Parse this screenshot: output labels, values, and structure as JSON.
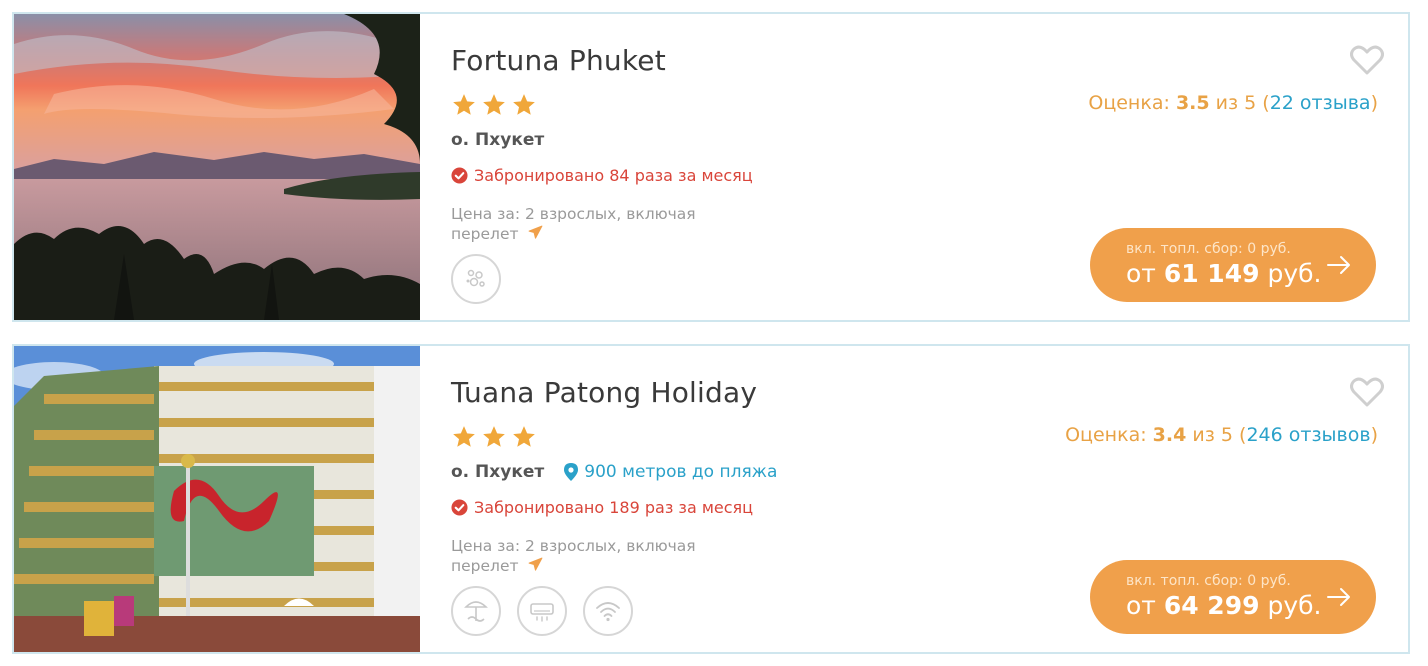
{
  "hotels": [
    {
      "name": "Fortuna Phuket",
      "stars": 3,
      "location": "о. Пхукет",
      "beach_distance": "",
      "booked": "Забронировано 84 раза за месяц",
      "price_for": "Цена за: 2 взрослых, включая перелет",
      "amenities": [
        "laundry-icon"
      ],
      "rating_label": "Оценка:",
      "rating_value": "3.5",
      "rating_of": "из 5",
      "reviews": "22 отзыва",
      "fee_note": "вкл. топл. сбор: 0 руб.",
      "price_prefix": "от",
      "price": "61 149",
      "currency": "руб."
    },
    {
      "name": "Tuana Patong Holiday",
      "stars": 3,
      "location": "о. Пхукет",
      "beach_distance": "900 метров до пляжа",
      "booked": "Забронировано 189 раз за месяц",
      "price_for": "Цена за: 2 взрослых, включая перелет",
      "amenities": [
        "beach-umbrella-icon",
        "air-conditioner-icon",
        "wifi-icon"
      ],
      "rating_label": "Оценка:",
      "rating_value": "3.4",
      "rating_of": "из 5",
      "reviews": "246 отзывов",
      "fee_note": "вкл. топл. сбор: 0 руб.",
      "price_prefix": "от",
      "price": "64 299",
      "currency": "руб."
    }
  ],
  "colors": {
    "star": "#f0a73a",
    "accent_orange": "#f0a04b",
    "link_blue": "#2aa1c9",
    "booked_red": "#d9453a",
    "card_border": "#cfe6ee"
  }
}
